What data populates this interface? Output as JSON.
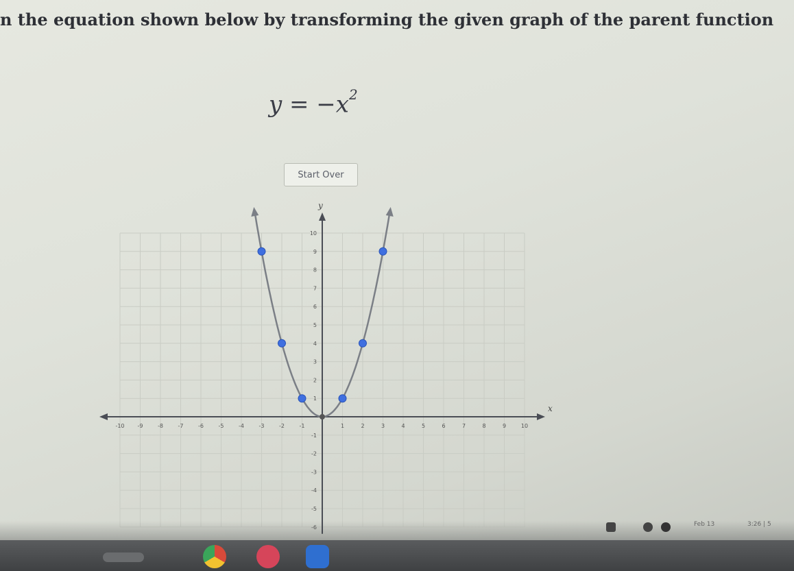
{
  "instruction": "n the equation shown below by transforming the given graph of the parent function",
  "equation": {
    "lhs": "y = −x",
    "exponent": "2"
  },
  "start_over_label": "Start Over",
  "graph": {
    "x_axis_label": "x",
    "y_axis_label": "y",
    "x_ticks": [
      -10,
      -9,
      -8,
      -7,
      -6,
      -5,
      -4,
      -3,
      -2,
      -1,
      1,
      2,
      3,
      4,
      5,
      6,
      7,
      8,
      9,
      10
    ],
    "y_ticks": [
      10,
      9,
      8,
      7,
      6,
      5,
      4,
      3,
      2,
      1,
      -1,
      -2,
      -3,
      -4,
      -5,
      -6
    ],
    "xlim": [
      -10,
      10
    ],
    "ylim": [
      -6,
      10
    ],
    "parabola_color": "#7b7f86",
    "point_color": "#3f6fe0",
    "points": [
      {
        "x": -3,
        "y": 9
      },
      {
        "x": -2,
        "y": 4
      },
      {
        "x": -1,
        "y": 1
      },
      {
        "x": 1,
        "y": 1
      },
      {
        "x": 2,
        "y": 4
      },
      {
        "x": 3,
        "y": 9
      }
    ]
  },
  "tray": {
    "time": "3:26 | 5",
    "text": "Feb 13"
  },
  "shelf": [
    "launcher-icon",
    "chrome-icon",
    "app-icon-red",
    "camera-icon"
  ]
}
